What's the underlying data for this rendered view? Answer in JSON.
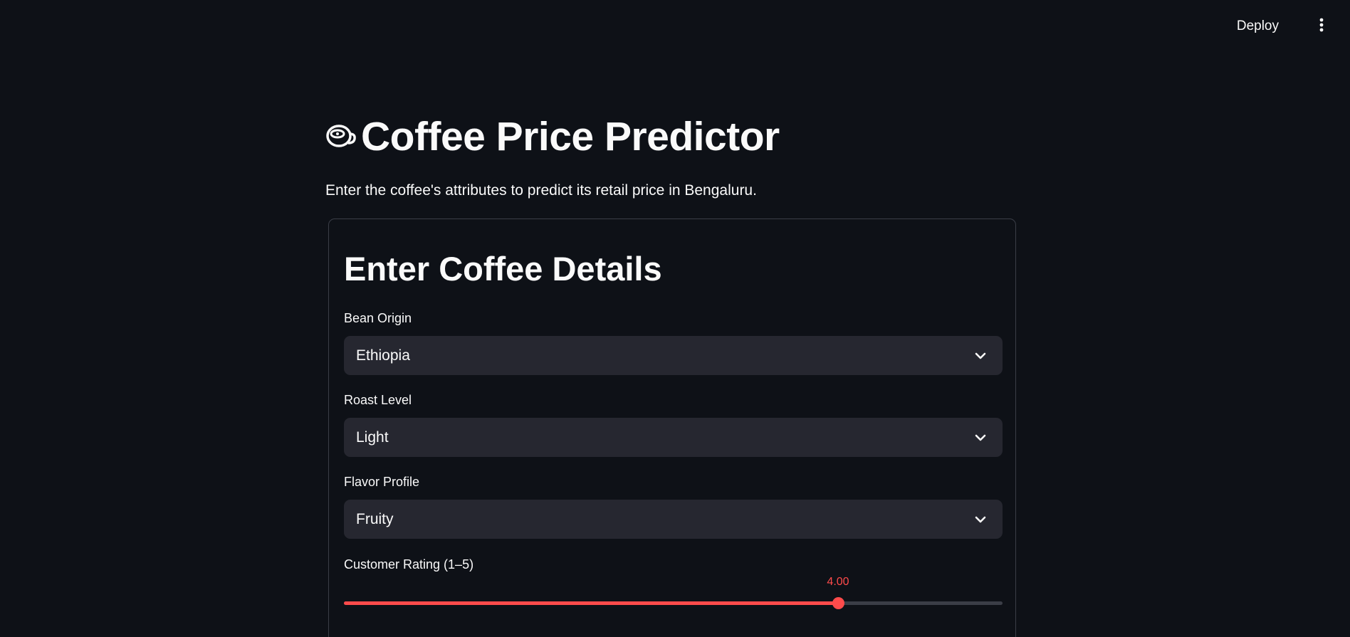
{
  "header": {
    "deploy_label": "Deploy",
    "menu_icon": "vertical-dots-icon"
  },
  "main": {
    "title_icon": "coffee-cup-icon",
    "title": "Coffee Price Predictor",
    "subtitle": "Enter the coffee's attributes to predict its retail price in Bengaluru."
  },
  "form": {
    "title": "Enter Coffee Details",
    "bean_origin": {
      "label": "Bean Origin",
      "value": "Ethiopia"
    },
    "roast_level": {
      "label": "Roast Level",
      "value": "Light"
    },
    "flavor_profile": {
      "label": "Flavor Profile",
      "value": "Fruity"
    },
    "customer_rating": {
      "label": "Customer Rating (1–5)",
      "value_label": "4.00",
      "fraction": 0.75
    }
  },
  "colors": {
    "background": "#0e1117",
    "input_bg": "#262730",
    "accent": "#ff4b4b",
    "text": "#fafafa"
  }
}
